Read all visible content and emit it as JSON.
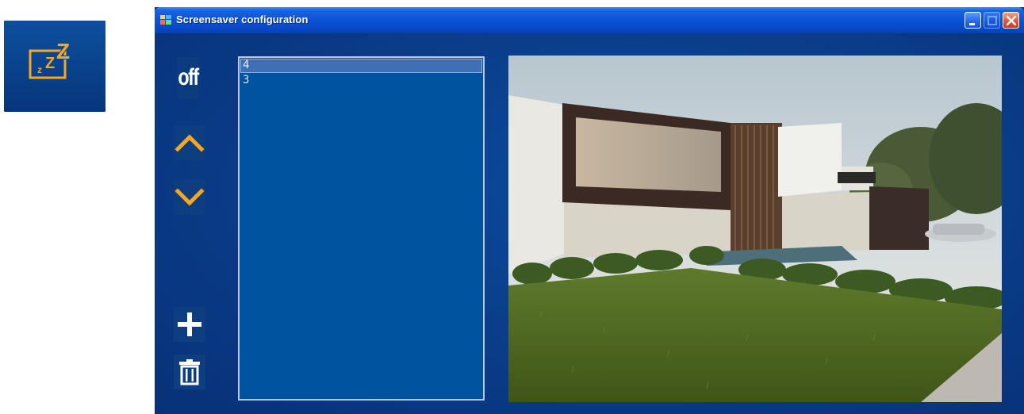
{
  "app_icon": {
    "icon": "sleep-zzz-icon",
    "glyphs": "zZZ"
  },
  "window": {
    "title": "Screensaver configuration",
    "title_icon": "app-title-icon",
    "controls": {
      "minimize": "minimize-icon",
      "maximize": "maximize-icon",
      "close": "close-icon"
    }
  },
  "toolbar": {
    "off_label": "off",
    "up_icon": "chevron-up-icon",
    "down_icon": "chevron-down-icon",
    "add_icon": "plus-icon",
    "delete_icon": "trash-icon"
  },
  "list": {
    "items": [
      {
        "label": "4",
        "selected": true
      },
      {
        "label": "3",
        "selected": false
      }
    ]
  },
  "preview": {
    "image": "house-exterior-photo"
  },
  "colors": {
    "window_bg": "#0b3c86",
    "accent_orange": "#f5a623",
    "list_bg": "#00539e",
    "titlebar": "#0a52d8"
  }
}
